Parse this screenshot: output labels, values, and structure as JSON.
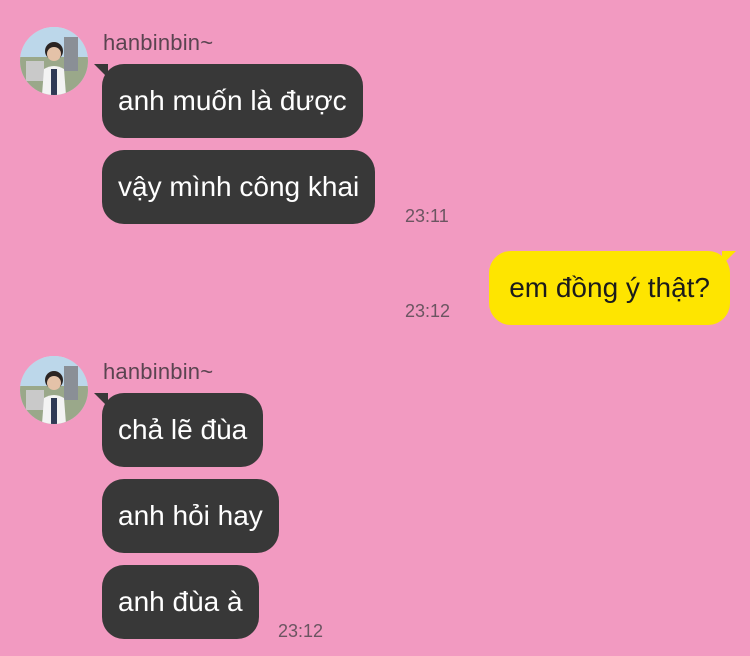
{
  "chat": {
    "groups": [
      {
        "sender": "hanbinbin~",
        "messages": [
          "anh muốn là được",
          "vậy mình công khai"
        ],
        "time": "23:11"
      },
      {
        "outgoing": true,
        "messages": [
          "em đồng ý thật?"
        ],
        "time": "23:12"
      },
      {
        "sender": "hanbinbin~",
        "messages": [
          "chả lẽ đùa",
          "anh hỏi hay",
          "anh đùa à"
        ],
        "time": "23:12"
      }
    ]
  },
  "colors": {
    "background": "#f29ac1",
    "incoming_bubble": "#383838",
    "outgoing_bubble": "#fee500"
  },
  "icons": {
    "avatar": "profile-photo"
  }
}
